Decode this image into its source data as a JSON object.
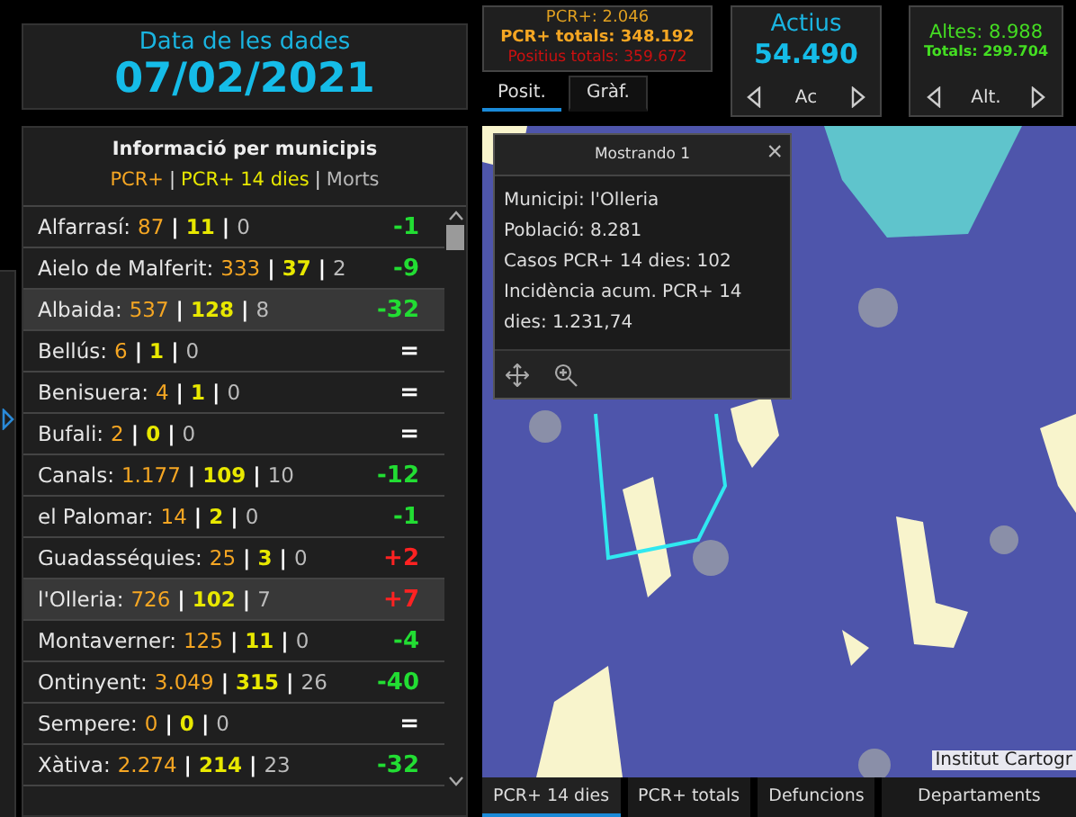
{
  "date_card": {
    "label": "Data de les dades",
    "date": "07/02/2021"
  },
  "municipalities": {
    "title": "Informació per municipis",
    "legend": [
      {
        "text": "PCR+",
        "color": "#f5a623"
      },
      {
        "text": "PCR+ 14 dies",
        "color": "#e8e800"
      },
      {
        "text": "Morts",
        "color": "#b8b8b8"
      }
    ],
    "separator": "|",
    "rows": [
      {
        "name": "Alfarrasí:",
        "pcr": "87",
        "pcr14": "11",
        "deaths": "0",
        "change": "-1",
        "kind": "down",
        "highlighted": false
      },
      {
        "name": "Aielo de Malferit:",
        "pcr": "333",
        "pcr14": "37",
        "deaths": "2",
        "change": "-9",
        "kind": "down",
        "highlighted": false
      },
      {
        "name": "Albaida:",
        "pcr": "537",
        "pcr14": "128",
        "deaths": "8",
        "change": "-32",
        "kind": "down",
        "highlighted": true
      },
      {
        "name": "Bellús:",
        "pcr": "6",
        "pcr14": "1",
        "deaths": "0",
        "change": "=",
        "kind": "same",
        "highlighted": false
      },
      {
        "name": "Benisuera:",
        "pcr": "4",
        "pcr14": "1",
        "deaths": "0",
        "change": "=",
        "kind": "same",
        "highlighted": false
      },
      {
        "name": "Bufali:",
        "pcr": "2",
        "pcr14": "0",
        "deaths": "0",
        "change": "=",
        "kind": "same",
        "highlighted": false
      },
      {
        "name": "Canals:",
        "pcr": "1.177",
        "pcr14": "109",
        "deaths": "10",
        "change": "-12",
        "kind": "down",
        "highlighted": false
      },
      {
        "name": "el Palomar:",
        "pcr": "14",
        "pcr14": "2",
        "deaths": "0",
        "change": "-1",
        "kind": "down",
        "highlighted": false
      },
      {
        "name": "Guadasséquies:",
        "pcr": "25",
        "pcr14": "3",
        "deaths": "0",
        "change": "+2",
        "kind": "up",
        "highlighted": false
      },
      {
        "name": "l'Olleria:",
        "pcr": "726",
        "pcr14": "102",
        "deaths": "7",
        "change": "+7",
        "kind": "up",
        "highlighted": true
      },
      {
        "name": "Montaverner:",
        "pcr": "125",
        "pcr14": "11",
        "deaths": "0",
        "change": "-4",
        "kind": "down",
        "highlighted": false
      },
      {
        "name": "Ontinyent:",
        "pcr": "3.049",
        "pcr14": "315",
        "deaths": "26",
        "change": "-40",
        "kind": "down",
        "highlighted": false
      },
      {
        "name": "Sempere:",
        "pcr": "0",
        "pcr14": "0",
        "deaths": "0",
        "change": "=",
        "kind": "same",
        "highlighted": false
      },
      {
        "name": "Xàtiva:",
        "pcr": "2.274",
        "pcr14": "214",
        "deaths": "23",
        "change": "-32",
        "kind": "down",
        "highlighted": false
      }
    ]
  },
  "positives_card": {
    "lines": [
      {
        "text": "PCR+: 2.046",
        "color": "#e0a020"
      },
      {
        "text": "PCR+ totals: 348.192",
        "color": "#f5a623"
      },
      {
        "text": "Positius totals: 359.672",
        "color": "#cc1010"
      }
    ],
    "tabs": [
      {
        "label": "Posit.",
        "selected": true
      },
      {
        "label": "Gràf.",
        "selected": false
      }
    ]
  },
  "active_card": {
    "title": "Actius",
    "value": "54.490",
    "nav_label": "Ac"
  },
  "discharges_card": {
    "main": "Altes: 8.988",
    "totals": "Totals: 299.704",
    "nav_label": "Alt."
  },
  "map": {
    "popup": {
      "title": "Mostrando 1",
      "close": "×",
      "lines": [
        "Municipi: l'Olleria",
        "Població: 8.281",
        "Casos PCR+ 14 dies: 102",
        "Incidència acum. PCR+ 14 dies: 1.231,74"
      ]
    },
    "attribution": "Institut Cartogr"
  },
  "map_tabs": [
    {
      "label": "PCR+ 14 dies",
      "selected": true
    },
    {
      "label": "PCR+ totals",
      "selected": false
    },
    {
      "label": "Defuncions",
      "selected": false
    },
    {
      "label": "Departaments",
      "selected": false
    }
  ]
}
